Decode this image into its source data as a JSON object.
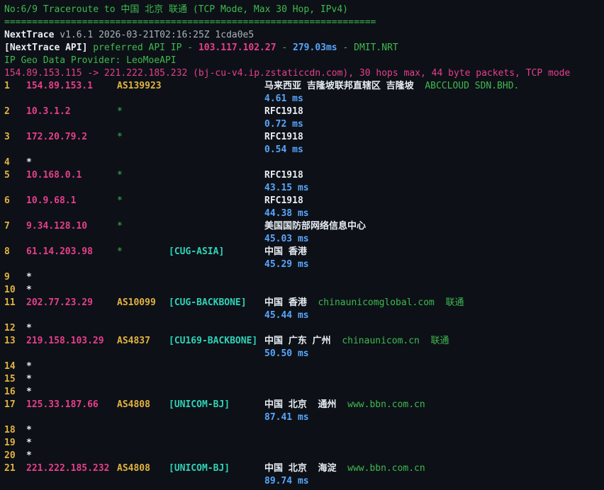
{
  "header": {
    "title_line": "No:6/9 Traceroute to 中国 北京 联通 (TCP Mode, Max 30 Hop, IPv4)",
    "separator": "===================================================================",
    "app_name": "NextTrace",
    "app_version": " v1.6.1 2026-03-21T02:16:25Z 1cda0e5",
    "api_label": "[NextTrace API]",
    "api_pref": " preferred API IP - ",
    "api_ip": "103.117.102.27",
    "api_dash": " - ",
    "api_latency": "279.03ms",
    "api_node": " - DMIT.NRT",
    "geo_provider": "IP Geo Data Provider: LeoMoeAPI",
    "trace_summary": "154.89.153.115 -> 221.222.185.232 (bj-cu-v4.ip.zstaticcdn.com), 30 hops max, 44 byte packets, TCP mode"
  },
  "hops": [
    {
      "num": "1",
      "ip": "154.89.153.1",
      "as": "AS139923",
      "tag": "",
      "geo": "马来西亚 吉隆坡联邦直辖区 吉隆坡",
      "extra": "ABCCLOUD SDN.BHD.",
      "rtt": "4.61 ms"
    },
    {
      "num": "2",
      "ip": "10.3.1.2",
      "as": "*",
      "tag": "",
      "geo": "RFC1918",
      "extra": "",
      "rtt": "0.72 ms"
    },
    {
      "num": "3",
      "ip": "172.20.79.2",
      "as": "*",
      "tag": "",
      "geo": "RFC1918",
      "extra": "",
      "rtt": "0.54 ms"
    },
    {
      "num": "4",
      "ip": "*"
    },
    {
      "num": "5",
      "ip": "10.168.0.1",
      "as": "*",
      "tag": "",
      "geo": "RFC1918",
      "extra": "",
      "rtt": "43.15 ms"
    },
    {
      "num": "6",
      "ip": "10.9.68.1",
      "as": "*",
      "tag": "",
      "geo": "RFC1918",
      "extra": "",
      "rtt": "44.38 ms"
    },
    {
      "num": "7",
      "ip": "9.34.128.10",
      "as": "*",
      "tag": "",
      "geo": "美国国防部网络信息中心",
      "extra": "",
      "rtt": "45.03 ms"
    },
    {
      "num": "8",
      "ip": "61.14.203.98",
      "as": "*",
      "tag": "[CUG-ASIA]",
      "geo": "中国 香港",
      "extra": "",
      "rtt": "45.29 ms"
    },
    {
      "num": "9",
      "ip": "*"
    },
    {
      "num": "10",
      "ip": "*"
    },
    {
      "num": "11",
      "ip": "202.77.23.29",
      "as": "AS10099",
      "tag": "[CUG-BACKBONE]",
      "geo": "中国 香港",
      "extra": "chinaunicomglobal.com  联通",
      "rtt": "45.44 ms"
    },
    {
      "num": "12",
      "ip": "*"
    },
    {
      "num": "13",
      "ip": "219.158.103.29",
      "as": "AS4837",
      "tag": "[CU169-BACKBONE]",
      "geo": "中国 广东 广州",
      "extra": "chinaunicom.cn  联通",
      "rtt": "50.50 ms"
    },
    {
      "num": "14",
      "ip": "*"
    },
    {
      "num": "15",
      "ip": "*"
    },
    {
      "num": "16",
      "ip": "*"
    },
    {
      "num": "17",
      "ip": "125.33.187.66",
      "as": "AS4808",
      "tag": "[UNICOM-BJ]",
      "geo": "中国 北京  通州",
      "extra": "www.bbn.com.cn",
      "rtt": "87.41 ms"
    },
    {
      "num": "18",
      "ip": "*"
    },
    {
      "num": "19",
      "ip": "*"
    },
    {
      "num": "20",
      "ip": "*"
    },
    {
      "num": "21",
      "ip": "221.222.185.232",
      "as": "AS4808",
      "tag": "[UNICOM-BJ]",
      "geo": "中国 北京  海淀",
      "extra": "www.bbn.com.cn",
      "rtt": "89.74 ms"
    }
  ]
}
